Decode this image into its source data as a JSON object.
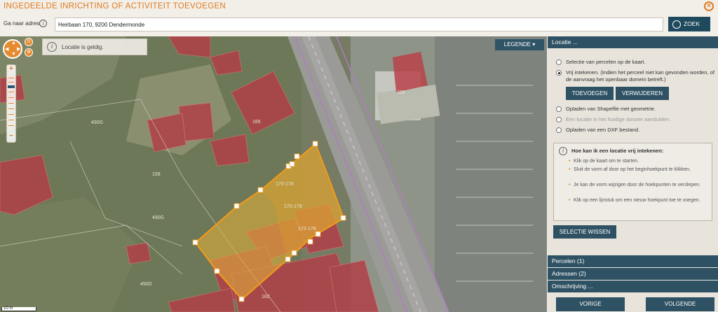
{
  "window": {
    "title": "INGEDEELDE INRICHTING OF ACTIVITEIT TOEVOEGEN",
    "close_icon": "close-icon"
  },
  "address": {
    "label": "Ga naar adres",
    "value": "Heirbaan 170, 9200 Dendermonde",
    "search_label": "ZOEK"
  },
  "map": {
    "tooltip": "Locatie is geldig.",
    "legend_label": "LEGENDE",
    "scale_label": "10 m",
    "parcel_labels": [
      "156",
      "166",
      "158",
      "170-178",
      "170-178",
      "172-178",
      "490G",
      "182",
      "490D",
      "490G"
    ],
    "colors": {
      "polygon_fill": "#d9a93a",
      "polygon_stroke": "#f0a21e",
      "building": "#b5444a"
    }
  },
  "panel": {
    "locatie_header": "Locatie ...",
    "options": [
      "Selectie van percelen op de kaart.",
      "Vrij intekenen. (Indien het perceel niet kan gevonden worden, of de aanvraag het openbaar domein betreft.)",
      "Opladen van Shapefile met geometrie.",
      "Een locatie in het huidige dossier aanduiden.",
      "Opladen van een DXF bestand."
    ],
    "selected_option": 1,
    "toevoegen_label": "TOEVOEGEN",
    "verwijderen_label": "VERWIJDEREN",
    "help": {
      "title": "Hoe kan ik een locatie vrij intekenen:",
      "items": [
        "Klik op de kaart om te starten.",
        "Sluit de vorm af door op het beginhoekpunt te klikken.",
        "Je kan de vorm wijzigen door de hoekpunten te verslepen.",
        "Klik op een lijnstuk om een nieuw hoekpunt toe te voegen."
      ]
    },
    "selectie_wissen_label": "SELECTIE WISSEN",
    "percelen_header": "Percelen (1)",
    "adressen_header": "Adressen (2)",
    "omschrijving_header": "Omschrijving ...",
    "vorige_label": "VORIGE",
    "volgende_label": "VOLGENDE"
  }
}
